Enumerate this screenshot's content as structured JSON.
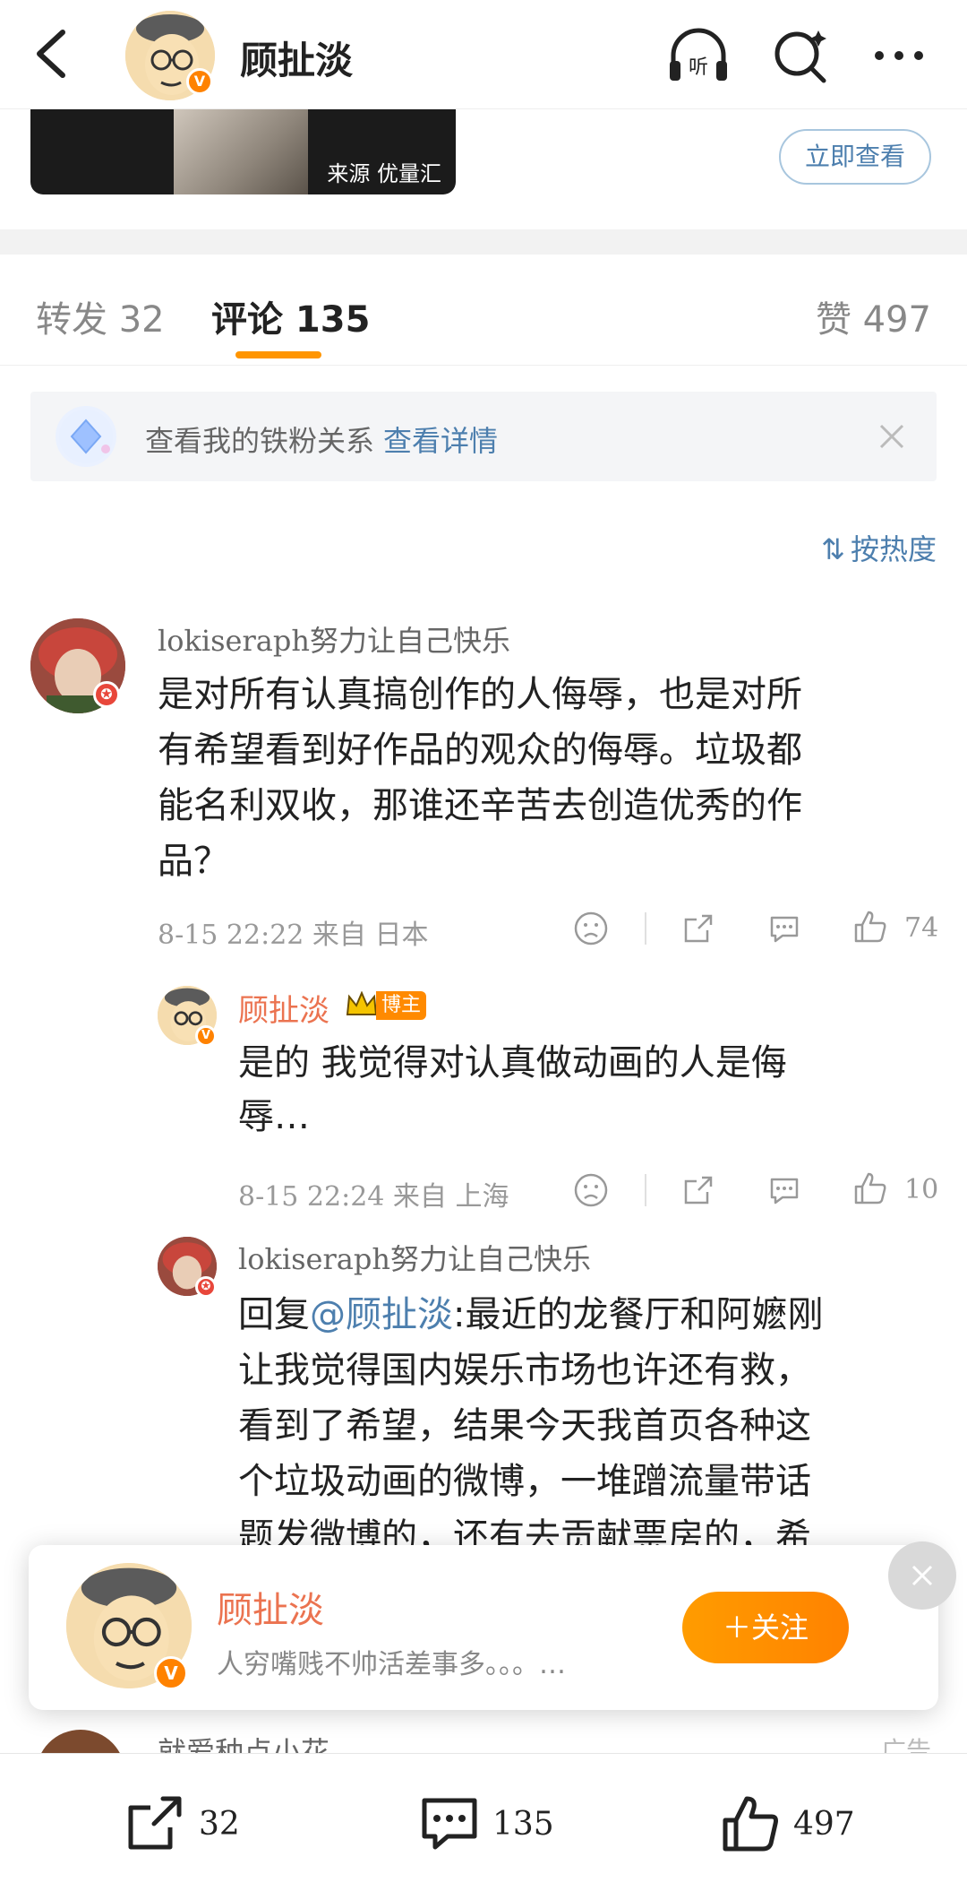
{
  "header": {
    "title": "顾扯淡",
    "verified_mark": "V",
    "icons": [
      "back-icon",
      "listen-icon",
      "search-icon",
      "more-icon"
    ],
    "listen_glyph": "听"
  },
  "ad": {
    "source": "来源 优量汇",
    "cta": "立即查看"
  },
  "tabs": [
    {
      "label": "转发 32"
    },
    {
      "label": "评论 135"
    },
    {
      "label": "赞 497"
    }
  ],
  "fan_banner": {
    "text": "查看我的铁粉关系",
    "link": "查看详情"
  },
  "sort": {
    "label": "按热度",
    "icon_glyph": "⇅"
  },
  "comments": [
    {
      "user": "lokiseraph努力让自己快乐",
      "lines": [
        "是对所有认真搞创作的人侮辱，也是对所",
        "有希望看到好作品的观众的侮辱。垃圾都",
        "能名利双收，那谁还辛苦去创造优秀的作",
        "品？"
      ],
      "meta": "8-15 22:22 来自 日本",
      "likes": "74"
    },
    {
      "user": "顾扯淡",
      "badge": "博主",
      "lines": [
        "是的 我觉得对认真做动画的人是侮",
        "辱…"
      ],
      "meta": "8-15 22:24 来自 上海",
      "likes": "10"
    },
    {
      "user": "lokiseraph努力让自己快乐",
      "reply_prefix": "回复",
      "mention": "@顾扯淡",
      "first_line_rest": ":最近的龙餐厅和阿嬷刚",
      "lines": [
        "让我觉得国内娱乐市场也许还有救，",
        "看到了希望，结果今天我首页各种这",
        "个垃圾动画的微博，一堆蹭流量带话",
        "题发微博的，还有去贡献票房的，希"
      ]
    }
  ],
  "follow_card": {
    "name": "顾扯淡",
    "bio": "人穷嘴贱不帅活差事多。。。…",
    "button": "＋关注"
  },
  "next_comment_peek": {
    "user": "就爱种点小花",
    "ad_label": "广告"
  },
  "bottom_bar": {
    "repost_count": "32",
    "comment_count": "135",
    "like_count": "497"
  },
  "colors": {
    "accent": "#ff9500",
    "link": "#4d7fae",
    "host_name": "#eb7350"
  }
}
